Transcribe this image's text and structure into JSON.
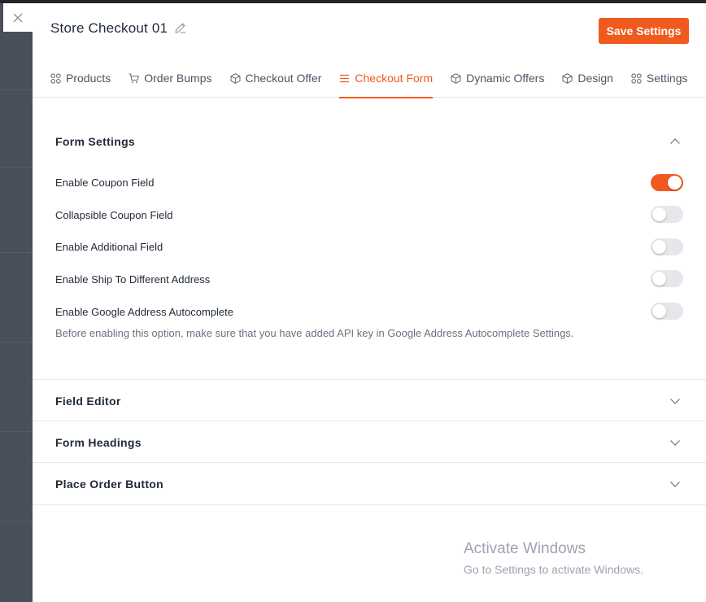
{
  "window": {
    "close_icon": "close-icon"
  },
  "header": {
    "title": "Store Checkout 01",
    "edit_icon": "pencil-edit-icon",
    "save_label": "Save Settings",
    "accent": "#f05a1f"
  },
  "tabs": [
    {
      "label": "Products",
      "icon": "grid-icon",
      "active": false
    },
    {
      "label": "Order Bumps",
      "icon": "cart-icon",
      "active": false
    },
    {
      "label": "Checkout Offer",
      "icon": "box-icon",
      "active": false
    },
    {
      "label": "Checkout Form",
      "icon": "list-icon",
      "active": true
    },
    {
      "label": "Dynamic Offers",
      "icon": "box-icon",
      "active": false
    },
    {
      "label": "Design",
      "icon": "box-icon",
      "active": false
    },
    {
      "label": "Settings",
      "icon": "grid-icon",
      "active": false
    }
  ],
  "form_settings": {
    "title": "Form Settings",
    "expanded": true,
    "rows": [
      {
        "label": "Enable Coupon Field",
        "enabled": true
      },
      {
        "label": "Collapsible Coupon Field",
        "enabled": false
      },
      {
        "label": "Enable Additional Field",
        "enabled": false
      },
      {
        "label": "Enable Ship To Different Address",
        "enabled": false
      },
      {
        "label": "Enable Google Address Autocomplete",
        "enabled": false
      }
    ],
    "help_text": "Before enabling this option, make sure that you have added API key in Google Address Autocomplete Settings."
  },
  "accordions": [
    {
      "title": "Field Editor",
      "expanded": false
    },
    {
      "title": "Form Headings",
      "expanded": false
    },
    {
      "title": "Place Order Button",
      "expanded": false
    }
  ],
  "watermark": {
    "title": "Activate Windows",
    "subtitle": "Go to Settings to activate Windows."
  }
}
